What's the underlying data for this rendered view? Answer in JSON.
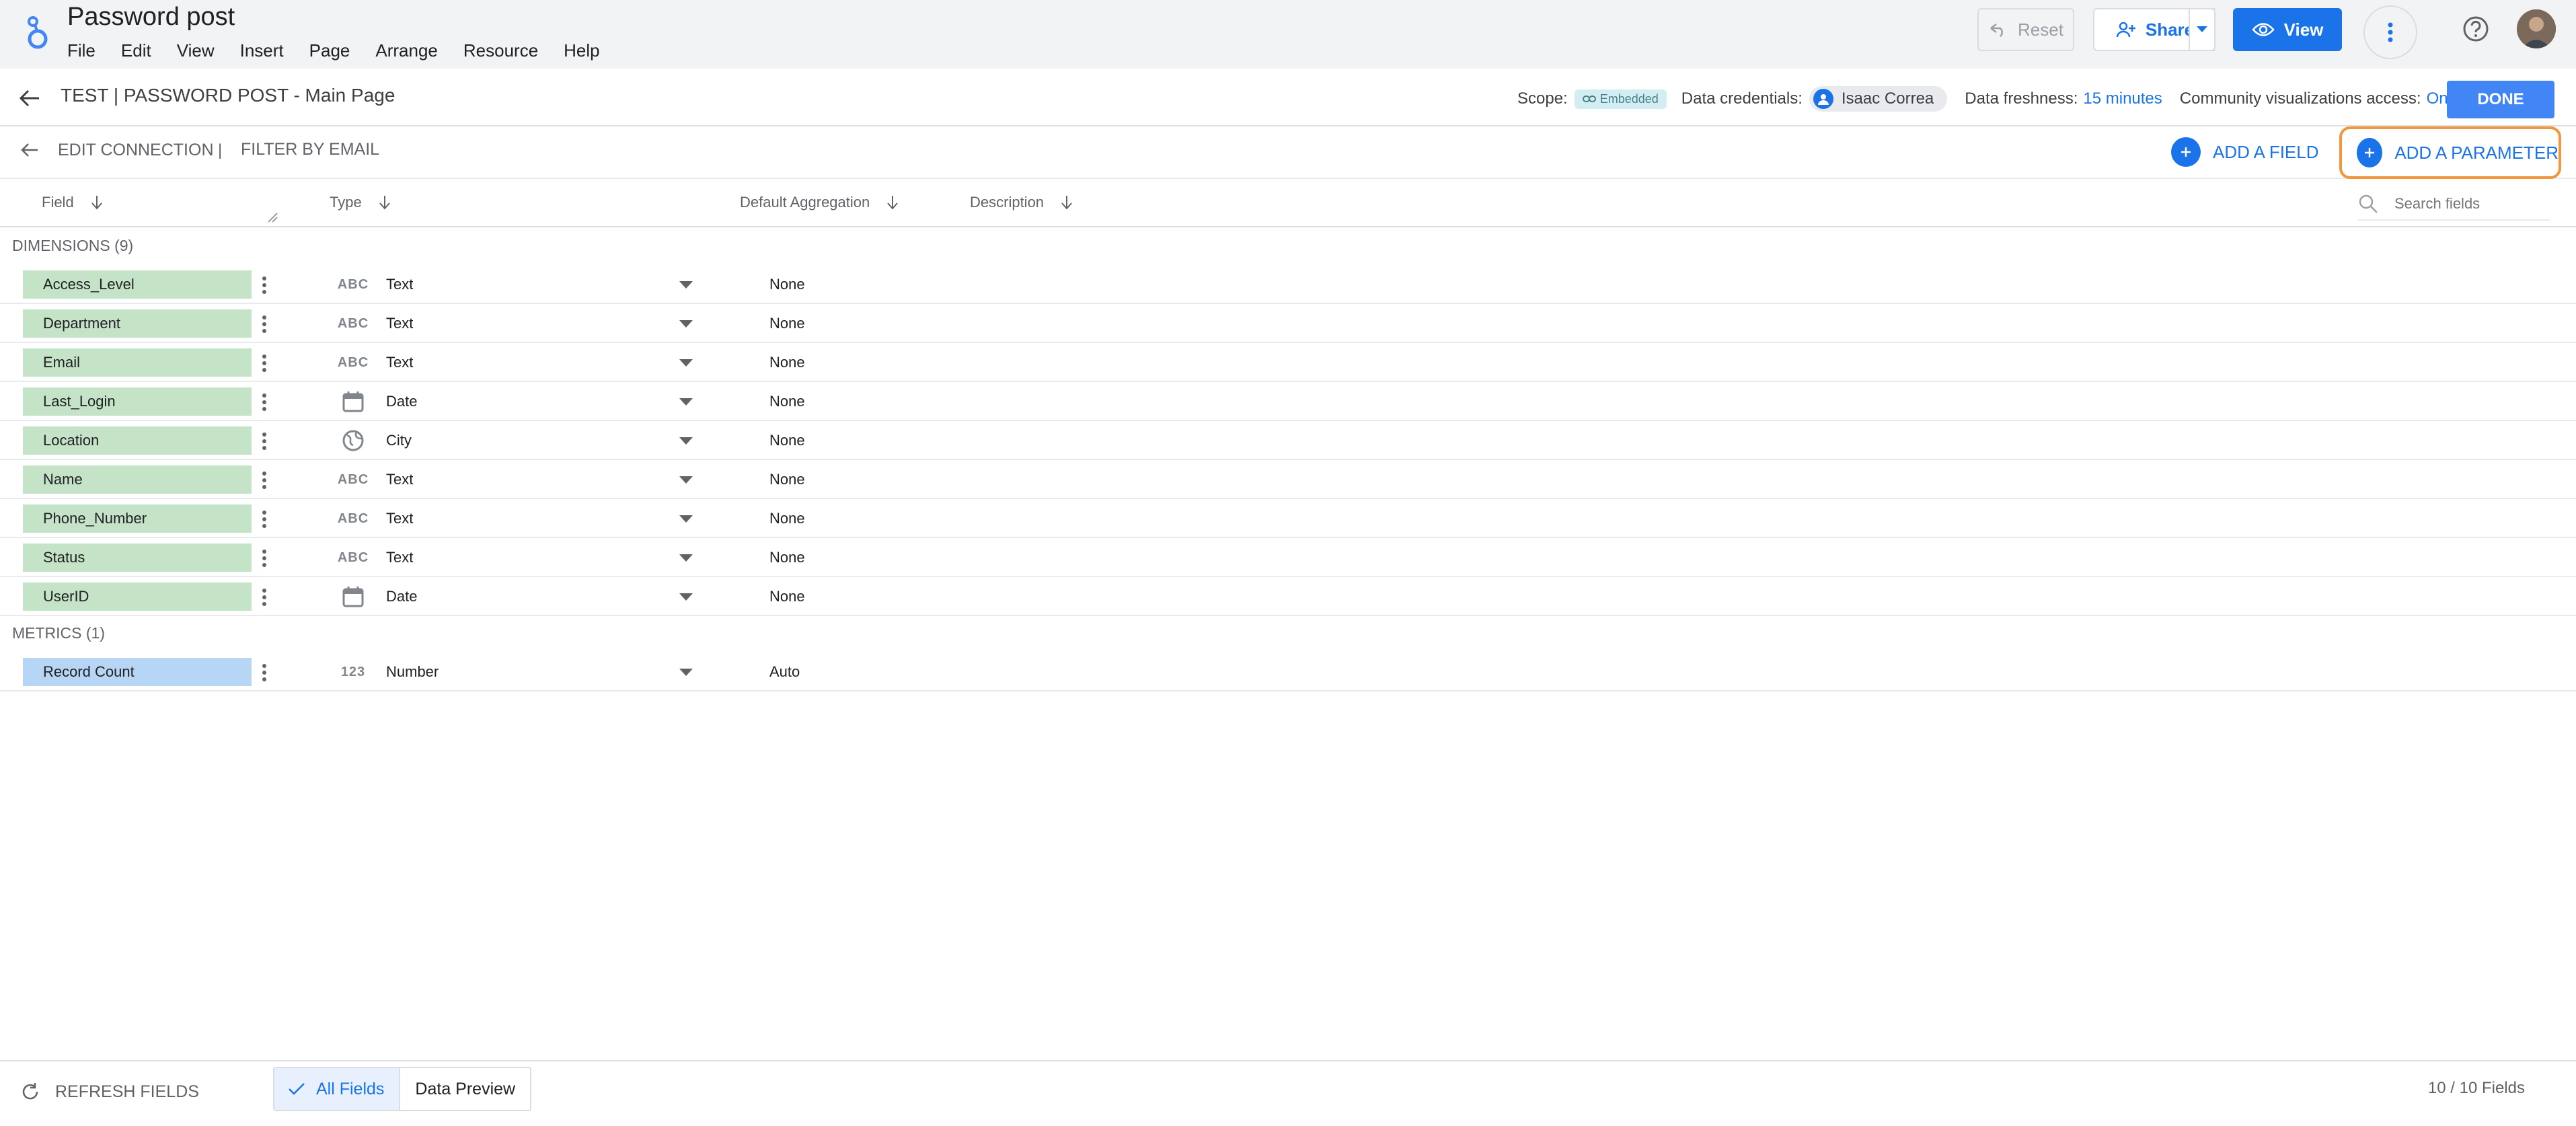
{
  "app": {
    "doc_title": "Password post",
    "menu": [
      "File",
      "Edit",
      "View",
      "Insert",
      "Page",
      "Arrange",
      "Resource",
      "Help"
    ],
    "reset_label": "Reset",
    "share_label": "Share",
    "view_label": "View",
    "drag_handle": "....",
    "brand_color": "#1a73e8"
  },
  "page": {
    "title": "TEST | PASSWORD POST - Main Page",
    "scope_label": "Scope:",
    "scope_value": "Embedded",
    "credentials_label": "Data credentials:",
    "credentials_user": "Isaac Correa",
    "freshness_label": "Data freshness:",
    "freshness_value": "15 minutes",
    "community_label": "Community visualizations access:",
    "community_value": "On",
    "done_label": "DONE"
  },
  "connection": {
    "edit_label": "EDIT CONNECTION",
    "separator": "|",
    "filter_label": "FILTER BY EMAIL",
    "add_field_label": "ADD A FIELD",
    "add_parameter_label": "ADD A PARAMETER",
    "highlight_color": "#f0963c"
  },
  "columns": {
    "field": "Field",
    "type": "Type",
    "default_aggregation": "Default Aggregation",
    "description": "Description",
    "search_placeholder": "Search fields"
  },
  "dimensions": {
    "label": "DIMENSIONS (9)",
    "color": "#c5e3c7",
    "rows": [
      {
        "name": "Access_Level",
        "type_icon": "ABC",
        "type": "Text",
        "agg": "None"
      },
      {
        "name": "Department",
        "type_icon": "ABC",
        "type": "Text",
        "agg": "None"
      },
      {
        "name": "Email",
        "type_icon": "ABC",
        "type": "Text",
        "agg": "None"
      },
      {
        "name": "Last_Login",
        "type_icon": "calendar-icon",
        "type": "Date",
        "agg": "None"
      },
      {
        "name": "Location",
        "type_icon": "globe-icon",
        "type": "City",
        "agg": "None"
      },
      {
        "name": "Name",
        "type_icon": "ABC",
        "type": "Text",
        "agg": "None"
      },
      {
        "name": "Phone_Number",
        "type_icon": "ABC",
        "type": "Text",
        "agg": "None"
      },
      {
        "name": "Status",
        "type_icon": "ABC",
        "type": "Text",
        "agg": "None"
      },
      {
        "name": "UserID",
        "type_icon": "calendar-icon",
        "type": "Date",
        "agg": "None"
      }
    ]
  },
  "metrics": {
    "label": "METRICS (1)",
    "color": "#b7d5f4",
    "rows": [
      {
        "name": "Record Count",
        "type_icon": "123",
        "type": "Number",
        "agg": "Auto"
      }
    ]
  },
  "footer": {
    "refresh_label": "REFRESH FIELDS",
    "all_fields_label": "All Fields",
    "data_preview_label": "Data Preview",
    "field_count": "10 / 10 Fields"
  }
}
